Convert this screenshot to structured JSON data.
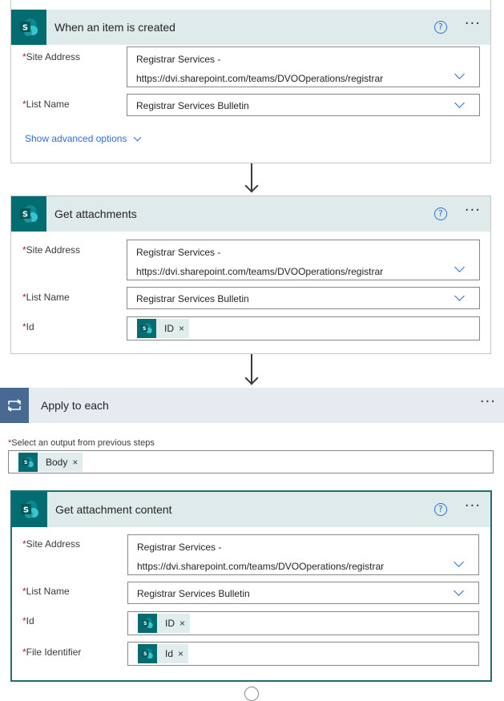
{
  "colors": {
    "sharepoint_teal": "#036c70",
    "header_bg": "#dfeaea",
    "link_blue": "#2b6fd6",
    "loop_blue": "#486991",
    "required_red": "#a4262c"
  },
  "card1": {
    "title": "When an item is created",
    "help_icon": "?",
    "more_icon": "···",
    "site_address_label": "Site Address",
    "site_address_line1": "Registrar Services -",
    "site_address_line2": "https://dvi.sharepoint.com/teams/DVOOperations/registrar",
    "list_name_label": "List Name",
    "list_name_value": "Registrar Services Bulletin",
    "advanced_link": "Show advanced options"
  },
  "card2": {
    "title": "Get attachments",
    "help_icon": "?",
    "more_icon": "···",
    "site_address_label": "Site Address",
    "site_address_line1": "Registrar Services -",
    "site_address_line2": "https://dvi.sharepoint.com/teams/DVOOperations/registrar",
    "list_name_label": "List Name",
    "list_name_value": "Registrar Services Bulletin",
    "id_label": "Id",
    "id_token": "ID",
    "token_remove": "×"
  },
  "loop": {
    "title": "Apply to each",
    "more_icon": "···",
    "select_label": "Select an output from previous steps",
    "select_token": "Body",
    "token_remove": "×"
  },
  "card3": {
    "title": "Get attachment content",
    "help_icon": "?",
    "more_icon": "···",
    "site_address_label": "Site Address",
    "site_address_line1": "Registrar Services -",
    "site_address_line2": "https://dvi.sharepoint.com/teams/DVOOperations/registrar",
    "list_name_label": "List Name",
    "list_name_value": "Registrar Services Bulletin",
    "id_label": "Id",
    "id_token": "ID",
    "file_identifier_label": "File Identifier",
    "file_identifier_token": "Id",
    "token_remove": "×"
  },
  "required_marker": "*"
}
